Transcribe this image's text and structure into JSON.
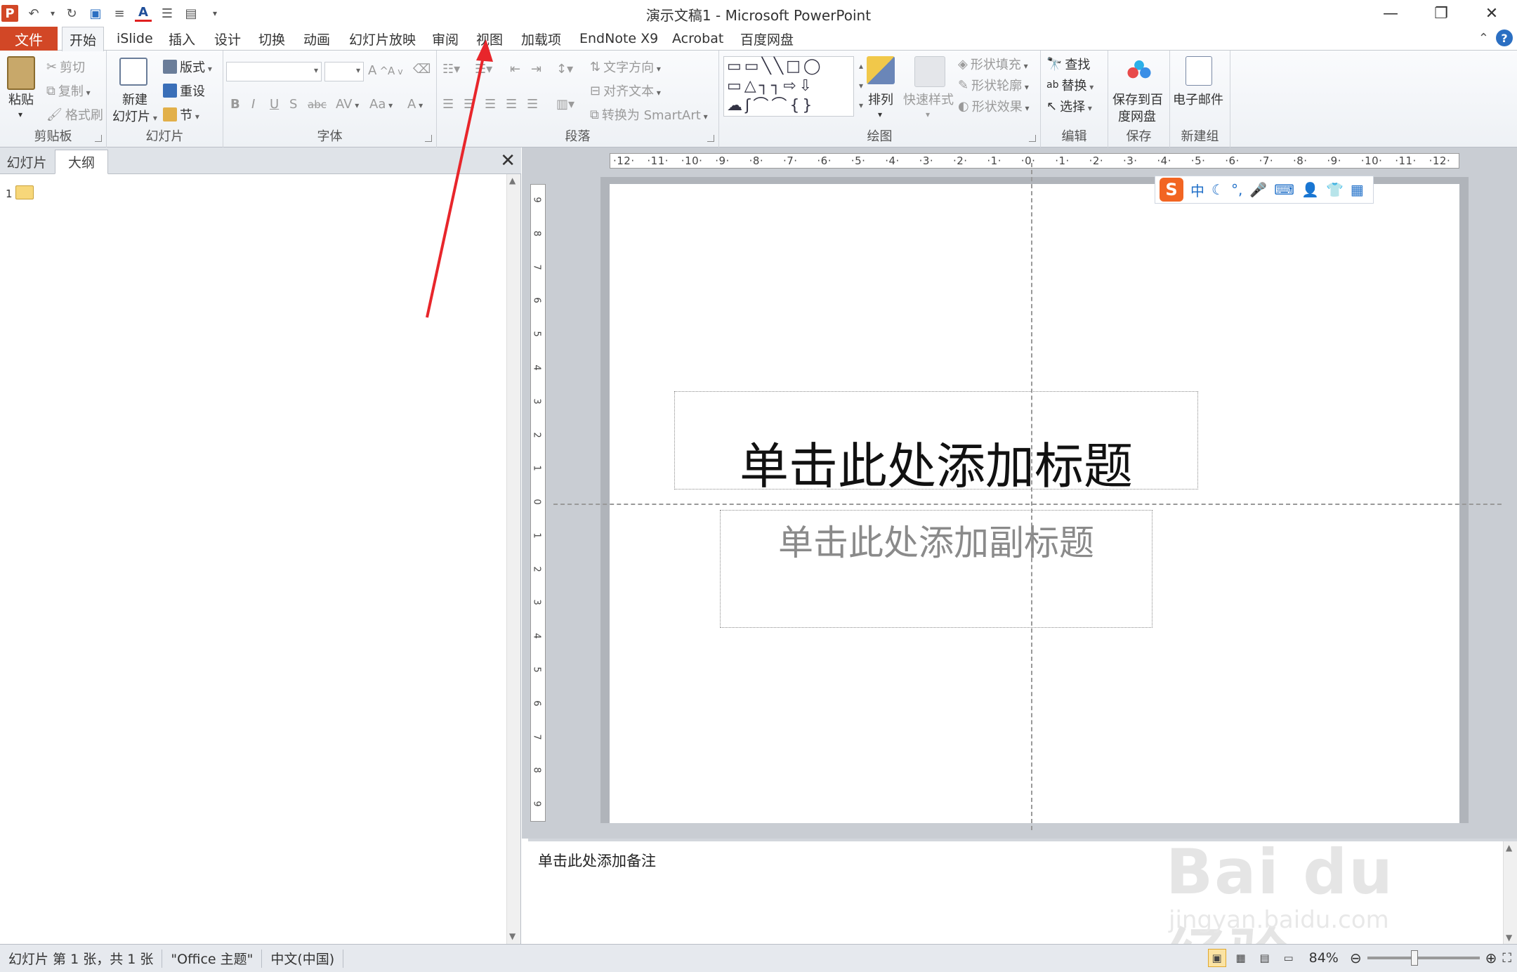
{
  "window": {
    "title": "演示文稿1 - Microsoft PowerPoint"
  },
  "tabs": {
    "file": "文件",
    "items": [
      "开始",
      "iSlide",
      "插入",
      "设计",
      "切换",
      "动画",
      "幻灯片放映",
      "审阅",
      "视图",
      "加载项",
      "EndNote X9",
      "Acrobat",
      "百度网盘"
    ],
    "active": "开始"
  },
  "ribbon": {
    "clipboard": {
      "label": "剪贴板",
      "paste": "粘贴",
      "cut": "剪切",
      "copy": "复制",
      "format_painter": "格式刷"
    },
    "slides": {
      "label": "幻灯片",
      "new_slide_1": "新建",
      "new_slide_2": "幻灯片",
      "layout": "版式",
      "reset": "重设",
      "section": "节"
    },
    "font": {
      "label": "字体",
      "bold": "B",
      "italic": "I",
      "underline": "U",
      "shadow": "S",
      "strike": "abc",
      "spacing": "AV",
      "case": "Aa",
      "grow": "A",
      "shrink": "A",
      "color": "A"
    },
    "paragraph": {
      "label": "段落",
      "text_direction": "文字方向",
      "align_text": "对齐文本",
      "smartart": "转换为 SmartArt"
    },
    "drawing": {
      "label": "绘图",
      "arrange": "排列",
      "quick_styles": "快速样式",
      "shape_fill": "形状填充",
      "shape_outline": "形状轮廓",
      "shape_effects": "形状效果"
    },
    "editing": {
      "label": "编辑",
      "find": "查找",
      "replace": "替换",
      "select": "选择"
    },
    "save": {
      "label": "保存",
      "save_baidu_1": "保存到百",
      "save_baidu_2": "度网盘"
    },
    "newgroup": {
      "label": "新建组",
      "email": "电子邮件"
    }
  },
  "left_panel": {
    "tab_slides": "幻灯片",
    "tab_outline": "大纲",
    "active": "大纲",
    "slide_number": "1"
  },
  "slide": {
    "title_placeholder": "单击此处添加标题",
    "subtitle_placeholder": "单击此处添加副标题"
  },
  "ruler": {
    "h_ticks": [
      "12",
      "11",
      "10",
      "9",
      "8",
      "7",
      "6",
      "5",
      "4",
      "3",
      "2",
      "1",
      "0",
      "1",
      "2",
      "3",
      "4",
      "5",
      "6",
      "7",
      "8",
      "9",
      "10",
      "11",
      "12"
    ],
    "v_ticks": [
      "9",
      "8",
      "7",
      "6",
      "5",
      "4",
      "3",
      "2",
      "1",
      "0",
      "1",
      "2",
      "3",
      "4",
      "5",
      "6",
      "7",
      "8",
      "9"
    ]
  },
  "ime": {
    "logo": "S",
    "mode": "中",
    "items": [
      "☾",
      "°,",
      "🎤",
      "⌨",
      "👤",
      "👕",
      "▦"
    ]
  },
  "notes": {
    "placeholder": "单击此处添加备注"
  },
  "status": {
    "slide_info": "幻灯片 第 1 张，共 1 张",
    "theme": "\"Office 主题\"",
    "language": "中文(中国)",
    "zoom": "84%",
    "zoom_level": 0.42
  },
  "watermark": {
    "main": "Bai du 经验",
    "sub": "jingyan.baidu.com"
  },
  "colors": {
    "accent": "#d24726",
    "tab_active_bg": "#f3f5f8",
    "arrow": "#e8262b",
    "ime_blue": "#1f6fc8"
  }
}
